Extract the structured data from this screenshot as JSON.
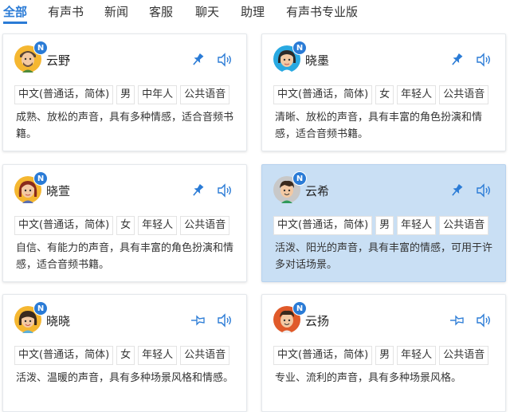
{
  "tabs": [
    "全部",
    "有声书",
    "新闻",
    "客服",
    "聊天",
    "助理",
    "有声书专业版"
  ],
  "badge_label": "N",
  "cards": [
    {
      "name": "云野",
      "avatar_icon": "avatar-man-beard-icon",
      "tags": [
        "中文(普通话，简体)",
        "男",
        "中年人",
        "公共语音"
      ],
      "description": "成熟、放松的声音，具有多种情感，适合音频书籍。",
      "pinned": true,
      "selected": false
    },
    {
      "name": "晓墨",
      "avatar_icon": "avatar-woman-dark-hair-icon",
      "tags": [
        "中文(普通话，简体)",
        "女",
        "年轻人",
        "公共语音"
      ],
      "description": "清晰、放松的声音，具有丰富的角色扮演和情感，适合音频书籍。",
      "pinned": true,
      "selected": false
    },
    {
      "name": "晓萱",
      "avatar_icon": "avatar-woman-red-hair-icon",
      "tags": [
        "中文(普通话，简体)",
        "女",
        "年轻人",
        "公共语音"
      ],
      "description": "自信、有能力的声音，具有丰富的角色扮演和情感，适合音频书籍。",
      "pinned": true,
      "selected": false
    },
    {
      "name": "云希",
      "avatar_icon": "avatar-young-man-icon",
      "tags": [
        "中文(普通话，简体)",
        "男",
        "年轻人",
        "公共语音"
      ],
      "description": "活泼、阳光的声音，具有丰富的情感，可用于许多对话场景。",
      "pinned": true,
      "selected": true
    },
    {
      "name": "晓晓",
      "avatar_icon": "avatar-girl-bangs-icon",
      "tags": [
        "中文(普通话，简体)",
        "女",
        "年轻人",
        "公共语音"
      ],
      "description": "活泼、温暖的声音，具有多种场景风格和情感。",
      "pinned": false,
      "selected": false
    },
    {
      "name": "云扬",
      "avatar_icon": "avatar-man-red-icon",
      "tags": [
        "中文(普通话，简体)",
        "男",
        "年轻人",
        "公共语音"
      ],
      "description": "专业、流利的声音，具有多种场景风格。",
      "pinned": false,
      "selected": false
    }
  ],
  "colors": {
    "accent": "#2a7bd6",
    "selected_card": "#c9dff4"
  }
}
